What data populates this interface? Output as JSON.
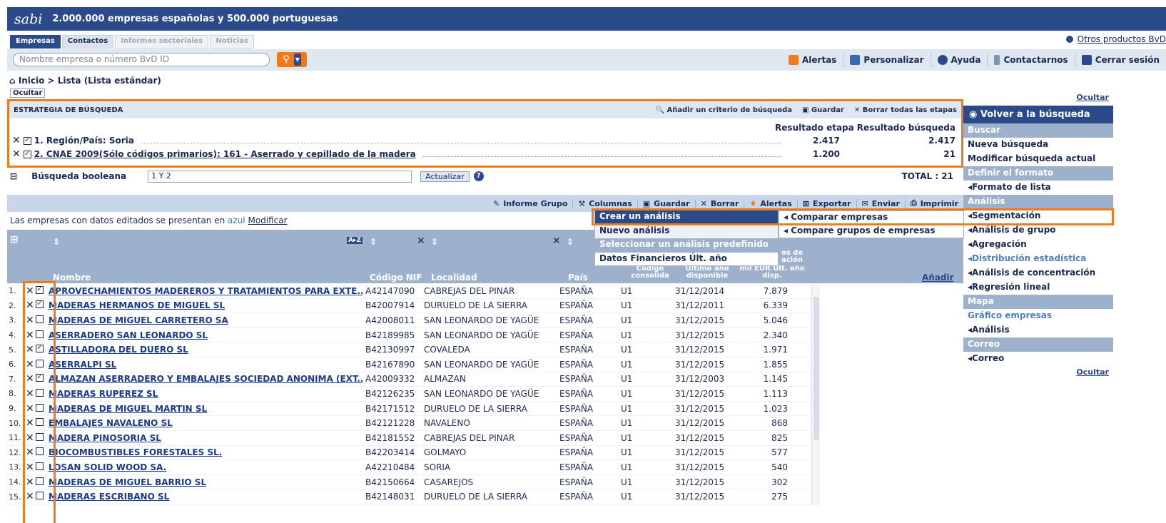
{
  "header": {
    "logo": "sabi",
    "tagline": "2.000.000 empresas españolas y 500.000 portuguesas"
  },
  "tabs": [
    {
      "label": "Empresas"
    },
    {
      "label": "Contactos"
    },
    {
      "label": "Informes sectoriales"
    },
    {
      "label": "Noticias"
    }
  ],
  "otros_productos": "Otros productos BvD",
  "search": {
    "placeholder": "Nombre empresa o número BvD ID"
  },
  "toplinks": [
    "Alertas",
    "Personalizar",
    "Ayuda",
    "Contactarnos",
    "Cerrar sesión"
  ],
  "breadcrumb": "Inicio > Lista (Lista estándar)",
  "ocultar": "Ocultar",
  "strategy": {
    "title": "ESTRATEGIA DE BÚSQUEDA",
    "actions": [
      "Añadir un criterio de búsqueda",
      "Guardar",
      "Borrar todas las etapas"
    ],
    "col_etapa": "Resultado etapa",
    "col_busqueda": "Resultado búsqueda",
    "steps": [
      {
        "label": "1. Región/País: Soria",
        "etapa": "2.417",
        "busqueda": "2.417"
      },
      {
        "label": "2. CNAE 2009(Sólo códigos primarios): 161 - Aserrado y cepillado de la madera",
        "etapa": "1.200",
        "busqueda": "21"
      }
    ]
  },
  "boolean": {
    "label": "Búsqueda booleana",
    "value": "1 Y 2",
    "update": "Actualizar",
    "total": "TOTAL : 21"
  },
  "list_toolbar": [
    "Informe Grupo",
    "Columnas",
    "Guardar",
    "Borrar",
    "Alertas",
    "Exportar",
    "Enviar",
    "Imprimir"
  ],
  "notice": {
    "text": "Las empresas con datos editados se presentan en",
    "blue": "azul",
    "link": "Modificar"
  },
  "columns": {
    "nombre": "Nombre",
    "nif": "Código NIF",
    "localidad": "Localidad",
    "pais": "País",
    "consolida": "Código consolida",
    "ultimo": "Último año disponible",
    "ingresos": "mil EUR Últ. año disp.",
    "ingresos_top": "os de ación",
    "anadir": "Añadir"
  },
  "rows": [
    {
      "n": "1.",
      "checked": true,
      "name": "APROVECHAMIENTOS MADEREROS Y TRATAMIENTOS PARA EXTE...",
      "nif": "A42147090",
      "loc": "CABREJAS DEL PINAR",
      "pais": "ESPAÑA",
      "cons": "U1",
      "date": "31/12/2014",
      "val": "7.879"
    },
    {
      "n": "2.",
      "checked": true,
      "name": "MADERAS HERMANOS DE MIGUEL SL",
      "nif": "B42007914",
      "loc": "DURUELO DE LA SIERRA",
      "pais": "ESPAÑA",
      "cons": "U1",
      "date": "31/12/2011",
      "val": "6.339"
    },
    {
      "n": "3.",
      "checked": false,
      "name": "MADERAS DE MIGUEL CARRETERO SA",
      "nif": "A42008011",
      "loc": "SAN LEONARDO DE YAGÜE",
      "pais": "ESPAÑA",
      "cons": "U1",
      "date": "31/12/2015",
      "val": "5.046"
    },
    {
      "n": "4.",
      "checked": false,
      "name": "ASERRADERO SAN LEONARDO SL",
      "nif": "B42189985",
      "loc": "SAN LEONARDO DE YAGÜE",
      "pais": "ESPAÑA",
      "cons": "U1",
      "date": "31/12/2015",
      "val": "2.340"
    },
    {
      "n": "5.",
      "checked": true,
      "name": "ASTILLADORA DEL DUERO SL",
      "nif": "B42130997",
      "loc": "COVALEDA",
      "pais": "ESPAÑA",
      "cons": "U1",
      "date": "31/12/2015",
      "val": "1.971"
    },
    {
      "n": "6.",
      "checked": false,
      "name": "ASERRALPI SL",
      "nif": "B42167890",
      "loc": "SAN LEONARDO DE YAGÜE",
      "pais": "ESPAÑA",
      "cons": "U1",
      "date": "31/12/2015",
      "val": "1.855"
    },
    {
      "n": "7.",
      "checked": true,
      "name": "ALMAZAN ASERRADERO Y EMBALAJES SOCIEDAD ANONIMA (EXT...",
      "nif": "A42009332",
      "loc": "ALMAZAN",
      "pais": "ESPAÑA",
      "cons": "U1",
      "date": "31/12/2003",
      "val": "1.145"
    },
    {
      "n": "8.",
      "checked": false,
      "name": "MADERAS RUPEREZ SL",
      "nif": "B42126235",
      "loc": "SAN LEONARDO DE YAGÜE",
      "pais": "ESPAÑA",
      "cons": "U1",
      "date": "31/12/2015",
      "val": "1.113"
    },
    {
      "n": "9.",
      "checked": false,
      "name": "MADERAS DE MIGUEL MARTIN SL",
      "nif": "B42171512",
      "loc": "DURUELO DE LA SIERRA",
      "pais": "ESPAÑA",
      "cons": "U1",
      "date": "31/12/2015",
      "val": "1.023"
    },
    {
      "n": "10.",
      "checked": false,
      "name": "EMBALAJES NAVALENO SL",
      "nif": "B42121228",
      "loc": "NAVALENO",
      "pais": "ESPAÑA",
      "cons": "U1",
      "date": "31/12/2015",
      "val": "868"
    },
    {
      "n": "11.",
      "checked": false,
      "name": "MADERA PINOSORIA SL",
      "nif": "B42181552",
      "loc": "CABREJAS DEL PINAR",
      "pais": "ESPAÑA",
      "cons": "U1",
      "date": "31/12/2015",
      "val": "825"
    },
    {
      "n": "12.",
      "checked": false,
      "name": "BIOCOMBUSTIBLES FORESTALES SL.",
      "nif": "B42203414",
      "loc": "GOLMAYO",
      "pais": "ESPAÑA",
      "cons": "U1",
      "date": "31/12/2015",
      "val": "577"
    },
    {
      "n": "13.",
      "checked": false,
      "name": "LOSAN SOLID WOOD SA.",
      "nif": "A42210484",
      "loc": "SORIA",
      "pais": "ESPAÑA",
      "cons": "U1",
      "date": "31/12/2015",
      "val": "540"
    },
    {
      "n": "14.",
      "checked": false,
      "name": "MADERAS DE MIGUEL BARRIO SL",
      "nif": "B42150664",
      "loc": "CASAREJOS",
      "pais": "ESPAÑA",
      "cons": "U1",
      "date": "31/12/2015",
      "val": "302"
    },
    {
      "n": "15.",
      "checked": false,
      "name": "MADERAS ESCRIBANO SL",
      "nif": "B42148031",
      "loc": "DURUELO DE LA SIERRA",
      "pais": "ESPAÑA",
      "cons": "U1",
      "date": "31/12/2015",
      "val": "275"
    }
  ],
  "menu": [
    "Crear un análisis",
    "Nuevo análisis",
    "Seleccionar un análisis predefinido",
    "Datos Financieros Últ. año"
  ],
  "submenu": [
    "Comparar empresas",
    "Compare grupos de empresas"
  ],
  "sidebar": {
    "volver": "Volver a la búsqueda",
    "sections": [
      {
        "head": "Buscar",
        "items": [
          "Nueva búsqueda",
          "Modificar búsqueda actual"
        ]
      },
      {
        "head": "Definir el formato",
        "items": [
          "Formato de lista"
        ]
      },
      {
        "head": "Análisis",
        "items": [
          "Segmentación",
          "Análisis de grupo",
          "Agregación",
          "Distribución estadística",
          "Análisis de concentración",
          "Regresión lineal"
        ]
      },
      {
        "head": "Mapa",
        "items": [
          "Gráfico empresas",
          "Análisis"
        ]
      },
      {
        "head": "Correo",
        "items": [
          "Correo"
        ]
      }
    ]
  },
  "colors": {
    "navy": "#2a4a8a",
    "orange": "#f07a1a",
    "header_gray": "#9db0cc"
  }
}
